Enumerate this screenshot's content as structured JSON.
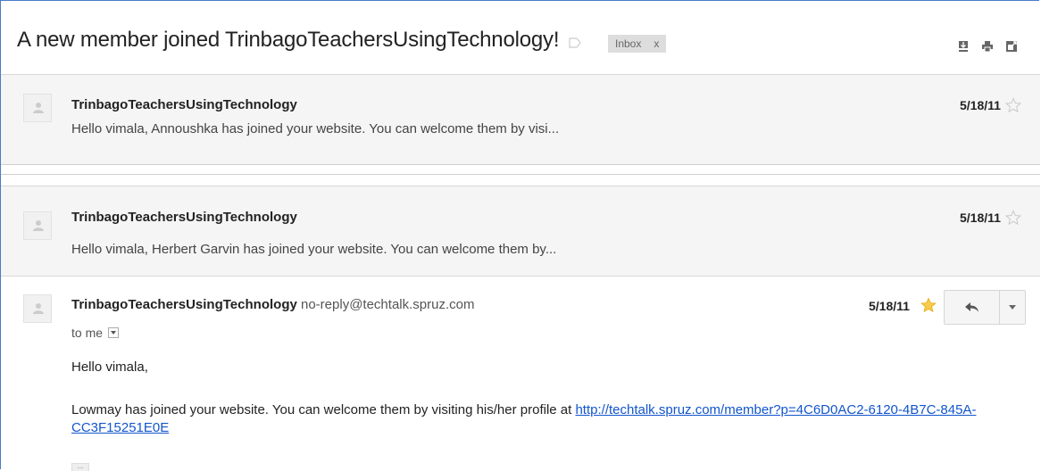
{
  "header": {
    "subject": "A new member joined TrinbagoTeachersUsingTechnology!",
    "label_chip": "Inbox",
    "label_chip_close": "x",
    "icons": [
      "download-icon",
      "print-icon",
      "new-window-icon"
    ]
  },
  "messages": [
    {
      "sender": "TrinbagoTeachersUsingTechnology",
      "snippet": "Hello vimala, Annoushka has joined your website. You can welcome them by visi...",
      "date": "5/18/11",
      "starred": false
    },
    {
      "sender": "TrinbagoTeachersUsingTechnology",
      "snippet": "Hello vimala, Herbert Garvin has joined your website. You can welcome them by...",
      "date": "5/18/11",
      "starred": false
    }
  ],
  "open_message": {
    "sender": "TrinbagoTeachersUsingTechnology",
    "email": "no-reply@techtalk.spruz.com",
    "date": "5/18/11",
    "starred": true,
    "to_label": "to me",
    "greeting": "Hello vimala,",
    "body_prefix": "Lowmay has joined your website. You can welcome them by visiting his/her profile at ",
    "link": "http://techtalk.spruz.com/member?p=4C6D0AC2-6120-4B7C-845A-CC3F15251E0E",
    "trim_label": "..."
  },
  "colors": {
    "star_on": "#f7cb4d",
    "star_off": "#c6c6c6",
    "link": "#1155cc",
    "frame_border": "#4a7bc8"
  }
}
